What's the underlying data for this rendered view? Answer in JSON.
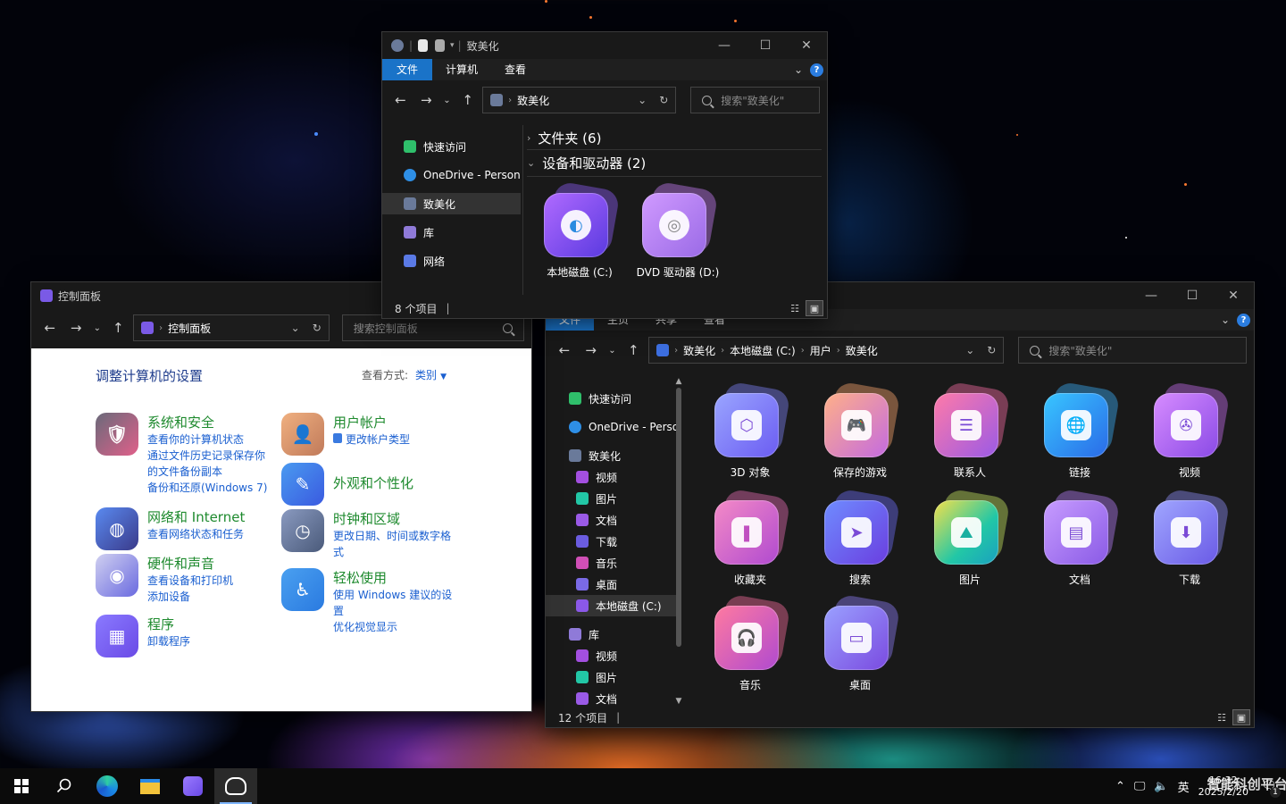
{
  "explorer_top": {
    "title": "致美化",
    "ribbon_tabs": [
      "文件",
      "计算机",
      "查看"
    ],
    "address": [
      "致美化"
    ],
    "search_placeholder": "搜索\"致美化\"",
    "sidebar": [
      "快速访问",
      "OneDrive - Personal",
      "致美化",
      "库",
      "网络"
    ],
    "groups": [
      "文件夹 (6)",
      "设备和驱动器 (2)"
    ],
    "drives": [
      "本地磁盘 (C:)",
      "DVD 驱动器 (D:)"
    ],
    "status": "8 个项目"
  },
  "control_panel": {
    "title": "控制面板",
    "address": [
      "控制面板"
    ],
    "search_placeholder": "搜索控制面板",
    "heading": "调整计算机的设置",
    "view_label": "查看方式:",
    "view_value": "类别",
    "categories": [
      {
        "title": "系统和安全",
        "links": [
          "查看你的计算机状态",
          "通过文件历史记录保存你的文件备份副本",
          "备份和还原(Windows 7)"
        ]
      },
      {
        "title": "网络和 Internet",
        "links": [
          "查看网络状态和任务"
        ]
      },
      {
        "title": "硬件和声音",
        "links": [
          "查看设备和打印机",
          "添加设备"
        ]
      },
      {
        "title": "程序",
        "links": [
          "卸载程序"
        ]
      },
      {
        "title": "用户帐户",
        "links": [
          "更改帐户类型"
        ]
      },
      {
        "title": "外观和个性化",
        "links": []
      },
      {
        "title": "时钟和区域",
        "links": [
          "更改日期、时间或数字格式"
        ]
      },
      {
        "title": "轻松使用",
        "links": [
          "使用 Windows 建议的设置",
          "优化视觉显示"
        ]
      }
    ]
  },
  "explorer_main": {
    "ribbon_tabs": [
      "文件",
      "主页",
      "共享",
      "查看"
    ],
    "address": [
      "致美化",
      "本地磁盘 (C:)",
      "用户",
      "致美化"
    ],
    "search_placeholder": "搜索\"致美化\"",
    "sidebar": [
      {
        "label": "快速访问"
      },
      {
        "label": "OneDrive - Personal"
      },
      {
        "label": "致美化"
      },
      {
        "label": "视频"
      },
      {
        "label": "图片"
      },
      {
        "label": "文档"
      },
      {
        "label": "下载"
      },
      {
        "label": "音乐"
      },
      {
        "label": "桌面"
      },
      {
        "label": "本地磁盘 (C:)"
      },
      {
        "label": "库"
      },
      {
        "label": "视频"
      },
      {
        "label": "图片"
      },
      {
        "label": "文档"
      }
    ],
    "items": [
      "3D 对象",
      "保存的游戏",
      "联系人",
      "链接",
      "视频",
      "收藏夹",
      "搜索",
      "图片",
      "文档",
      "下载",
      "音乐",
      "桌面"
    ],
    "status": "12 个项目"
  },
  "taskbar": {
    "ime": "英",
    "time": "16:32",
    "date": "2025/2/20",
    "notification_count": "1",
    "watermark": "智能科创平台"
  }
}
